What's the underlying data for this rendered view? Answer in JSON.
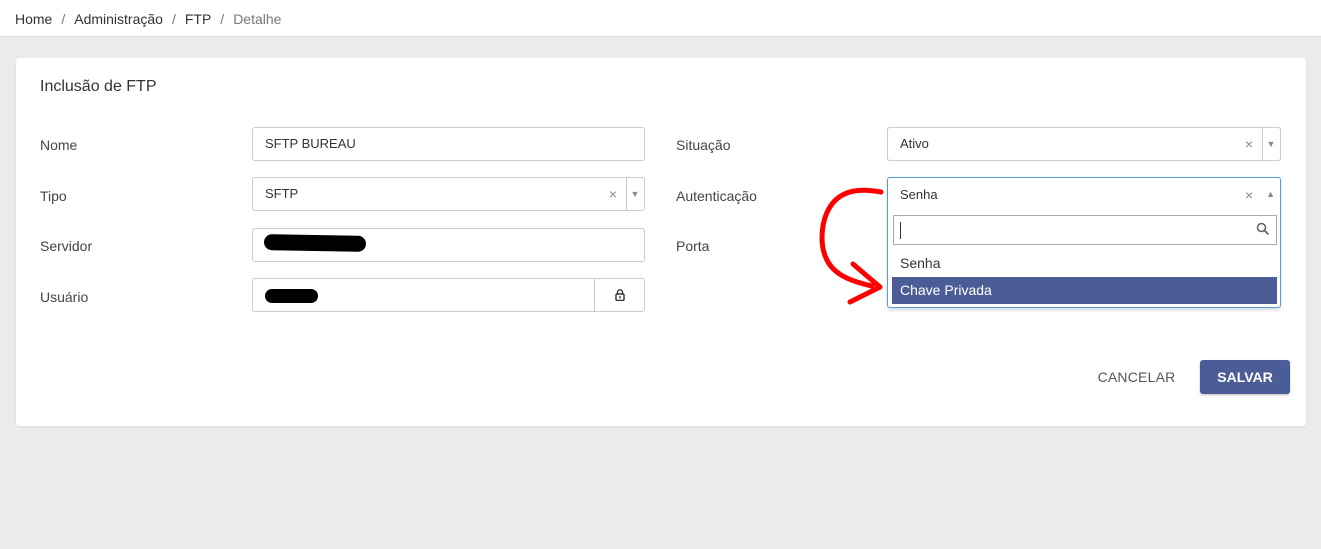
{
  "breadcrumb": {
    "items": [
      "Home",
      "Administração",
      "FTP"
    ],
    "current": "Detalhe",
    "separator": "/"
  },
  "form": {
    "title": "Inclusão de FTP",
    "nome": {
      "label": "Nome",
      "value": "SFTP BUREAU"
    },
    "tipo": {
      "label": "Tipo",
      "value": "SFTP",
      "clear": "×",
      "arrow": "▼"
    },
    "servidor": {
      "label": "Servidor"
    },
    "usuario": {
      "label": "Usuário"
    },
    "situacao": {
      "label": "Situação",
      "value": "Ativo",
      "clear": "×",
      "arrow": "▼"
    },
    "autenticacao": {
      "label": "Autenticação",
      "value": "Senha",
      "clear": "×",
      "arrow": "▲",
      "options": [
        "Senha",
        "Chave Privada"
      ],
      "highlighted": "Chave Privada"
    },
    "porta": {
      "label": "Porta"
    }
  },
  "actions": {
    "cancel": "CANCELAR",
    "save": "SALVAR"
  },
  "colors": {
    "primary": "#4b5d96",
    "annotation": "#ff0000",
    "focus_border": "#5b9bd5"
  },
  "icons": {
    "lock": "lock-icon",
    "search": "search-icon"
  }
}
